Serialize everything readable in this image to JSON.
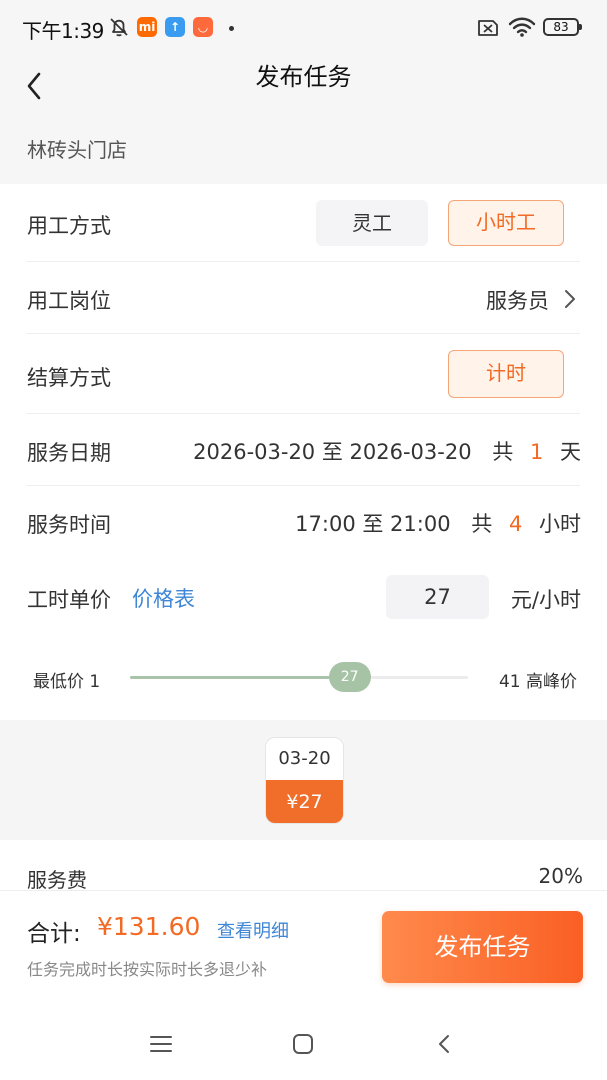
{
  "status_bar": {
    "time": "下午1:39",
    "battery": "83",
    "app_icon_colors": [
      "#ff6a00",
      "#3a9cf0",
      "#ff6a3c"
    ]
  },
  "nav": {
    "title": "发布任务"
  },
  "store": {
    "name": "林砖头门店"
  },
  "form": {
    "work_mode": {
      "label": "用工方式",
      "options": [
        "灵工",
        "小时工"
      ],
      "selected": "小时工"
    },
    "position": {
      "label": "用工岗位",
      "value": "服务员"
    },
    "settlement": {
      "label": "结算方式",
      "option": "计时"
    },
    "service_date": {
      "label": "服务日期",
      "range": "2026-03-20 至 2026-03-20",
      "total_prefix": "共",
      "count": "1",
      "unit": "天"
    },
    "service_time": {
      "label": "服务时间",
      "range": "17:00 至 21:00",
      "total_prefix": "共",
      "count": "4",
      "unit": "小时"
    },
    "unit_price": {
      "label": "工时单价",
      "link": "价格表",
      "value": "27",
      "unit": "元/小时"
    },
    "price_slider": {
      "min_label": "最低价 1",
      "max_label": "41 高峰价",
      "min": 1,
      "max": 41,
      "value": "27"
    }
  },
  "date_cards": [
    {
      "date": "03-20",
      "price": "¥27"
    }
  ],
  "service_fee": {
    "label": "服务费",
    "value": "20%"
  },
  "footer": {
    "total_label": "合计:",
    "total_value": "¥131.60",
    "detail_link": "查看明细",
    "note": "任务完成时长按实际时长多退少补",
    "submit": "发布任务"
  },
  "colors": {
    "accent": "#f26a23",
    "link": "#3f86d6",
    "slider": "#a7c3a6"
  }
}
